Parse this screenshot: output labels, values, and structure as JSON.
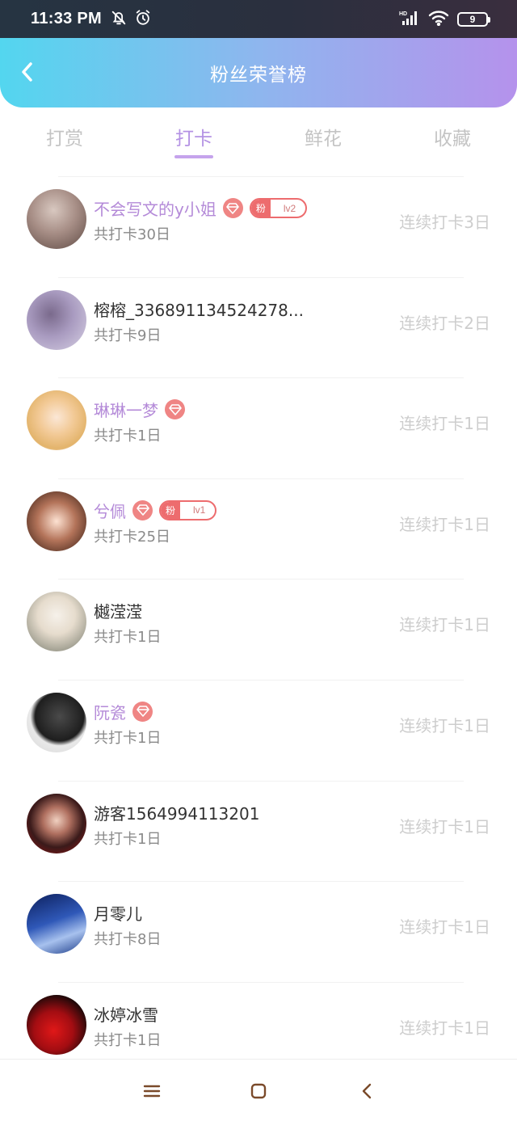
{
  "status_bar": {
    "time": "11:33 PM",
    "battery": "9",
    "icons": [
      "bell-off-icon",
      "alarm-icon",
      "hd-signal-icon",
      "wifi-icon",
      "battery-icon"
    ]
  },
  "header": {
    "title": "粉丝荣誉榜",
    "back_icon": "chevron-left-icon"
  },
  "colors": {
    "accent": "#b492e4",
    "gradient_start": "#53d6ef",
    "gradient_end": "#b592ec",
    "badge_red": "#ed6c6e"
  },
  "tabs": [
    {
      "label": "打赏",
      "active": false
    },
    {
      "label": "打卡",
      "active": true
    },
    {
      "label": "鲜花",
      "active": false
    },
    {
      "label": "收藏",
      "active": false
    }
  ],
  "fan_label": "粉",
  "users": [
    {
      "name": "不会写文的y小姐",
      "vip": true,
      "fan_level": "lv2",
      "total": "共打卡30日",
      "streak": "连续打卡3日"
    },
    {
      "name": "榕榕_336891134524278...",
      "vip": false,
      "fan_level": null,
      "total": "共打卡9日",
      "streak": "连续打卡2日"
    },
    {
      "name": "琳琳一梦",
      "vip": true,
      "fan_level": null,
      "total": "共打卡1日",
      "streak": "连续打卡1日"
    },
    {
      "name": "兮佩",
      "vip": true,
      "fan_level": "lv1",
      "total": "共打卡25日",
      "streak": "连续打卡1日"
    },
    {
      "name": "樾滢滢",
      "vip": false,
      "fan_level": null,
      "total": "共打卡1日",
      "streak": "连续打卡1日"
    },
    {
      "name": "阮瓷",
      "vip": true,
      "fan_level": null,
      "total": "共打卡1日",
      "streak": "连续打卡1日"
    },
    {
      "name": "游客1564994113201",
      "vip": false,
      "fan_level": null,
      "total": "共打卡1日",
      "streak": "连续打卡1日"
    },
    {
      "name": "月零儿",
      "vip": false,
      "fan_level": null,
      "total": "共打卡8日",
      "streak": "连续打卡1日"
    },
    {
      "name": "冰婷冰雪",
      "vip": false,
      "fan_level": null,
      "total": "共打卡1日",
      "streak": "连续打卡1日"
    }
  ],
  "nav": {
    "icons": [
      "menu-icon",
      "home-square-icon",
      "back-triangle-icon"
    ]
  }
}
